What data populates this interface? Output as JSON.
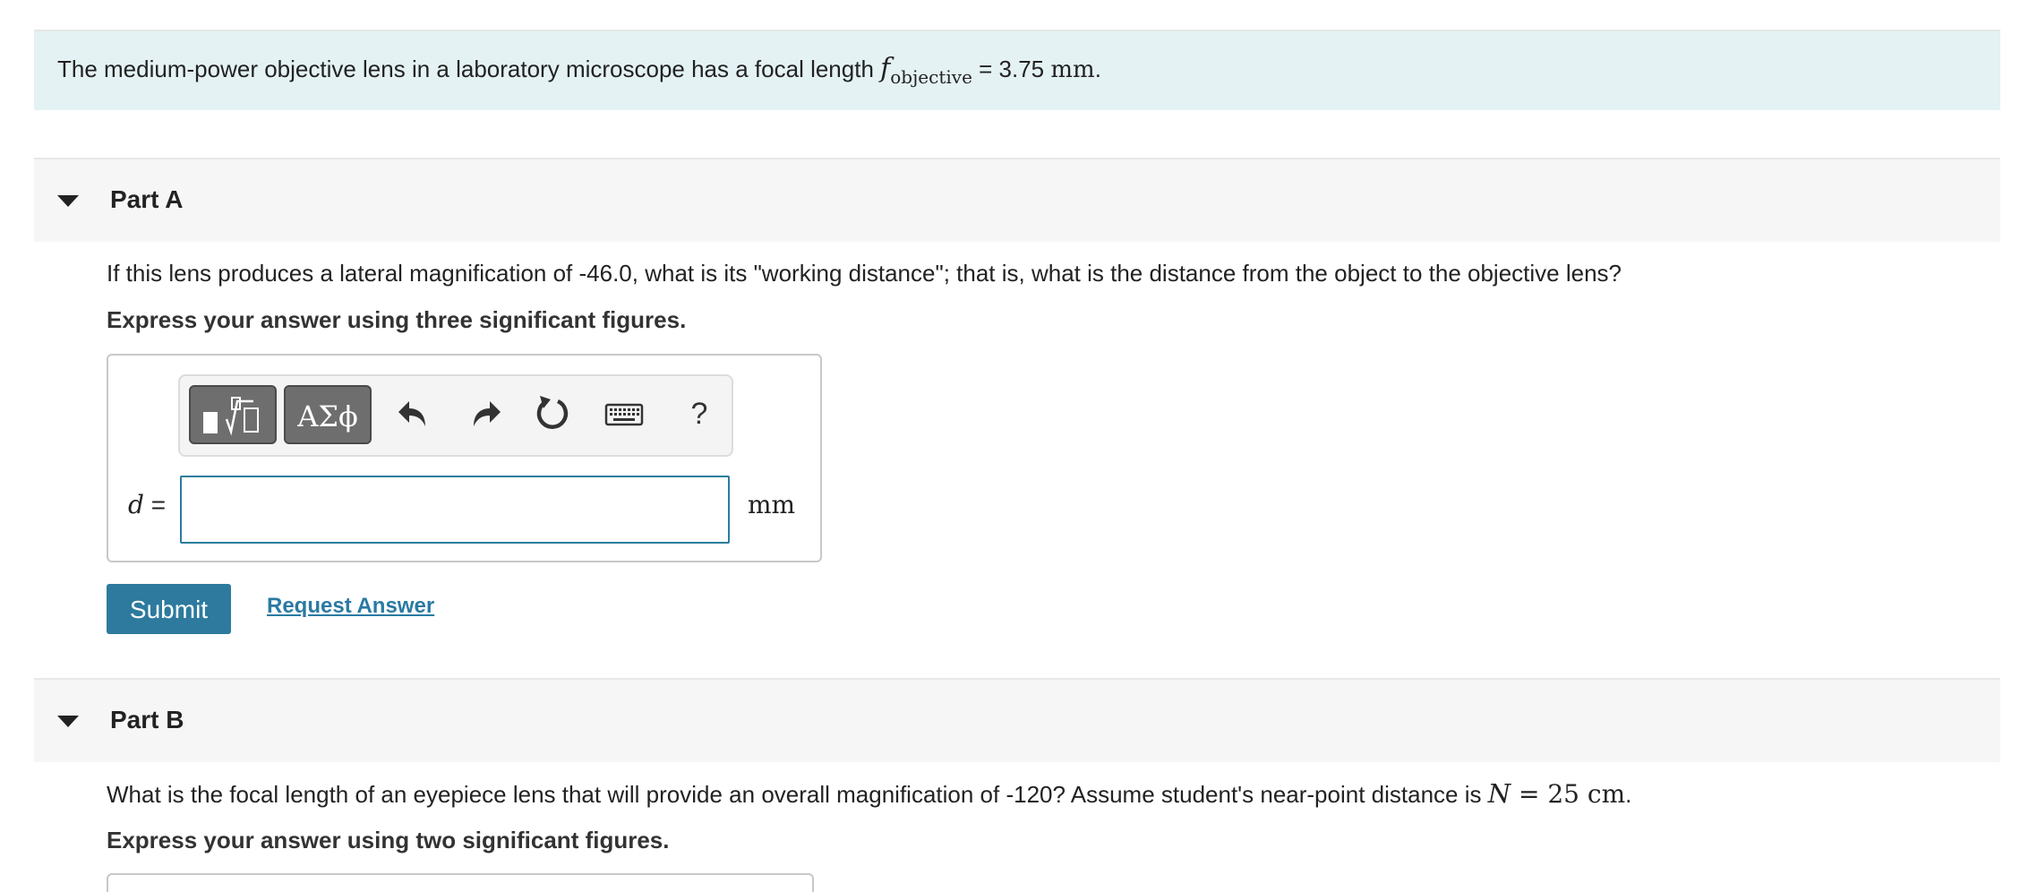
{
  "intro": {
    "text_before": "The medium-power objective lens in a laboratory microscope has a focal length ",
    "f_symbol": "f",
    "f_subscript": "objective",
    "equals": " = 3.75 ",
    "unit": "mm",
    "end": "."
  },
  "part_a": {
    "title": "Part A",
    "question": "If this lens produces a lateral magnification of -46.0, what is its \"working distance\"; that is, what is the distance from the object to the objective lens?",
    "instruction": "Express your answer using three significant figures.",
    "toolbar": {
      "greek_label": "ΑΣϕ",
      "help_label": "?"
    },
    "variable": "d",
    "equals": " =",
    "input_value": "",
    "unit": "mm",
    "submit_label": "Submit",
    "request_label": "Request Answer"
  },
  "part_b": {
    "title": "Part B",
    "question_before": "What is the focal length of an eyepiece lens that will provide an overall magnification of -120? Assume student's near-point distance is ",
    "n_symbol": "N",
    "n_equals": " = 25 cm",
    "end": ".",
    "instruction": "Express your answer using two significant figures."
  }
}
